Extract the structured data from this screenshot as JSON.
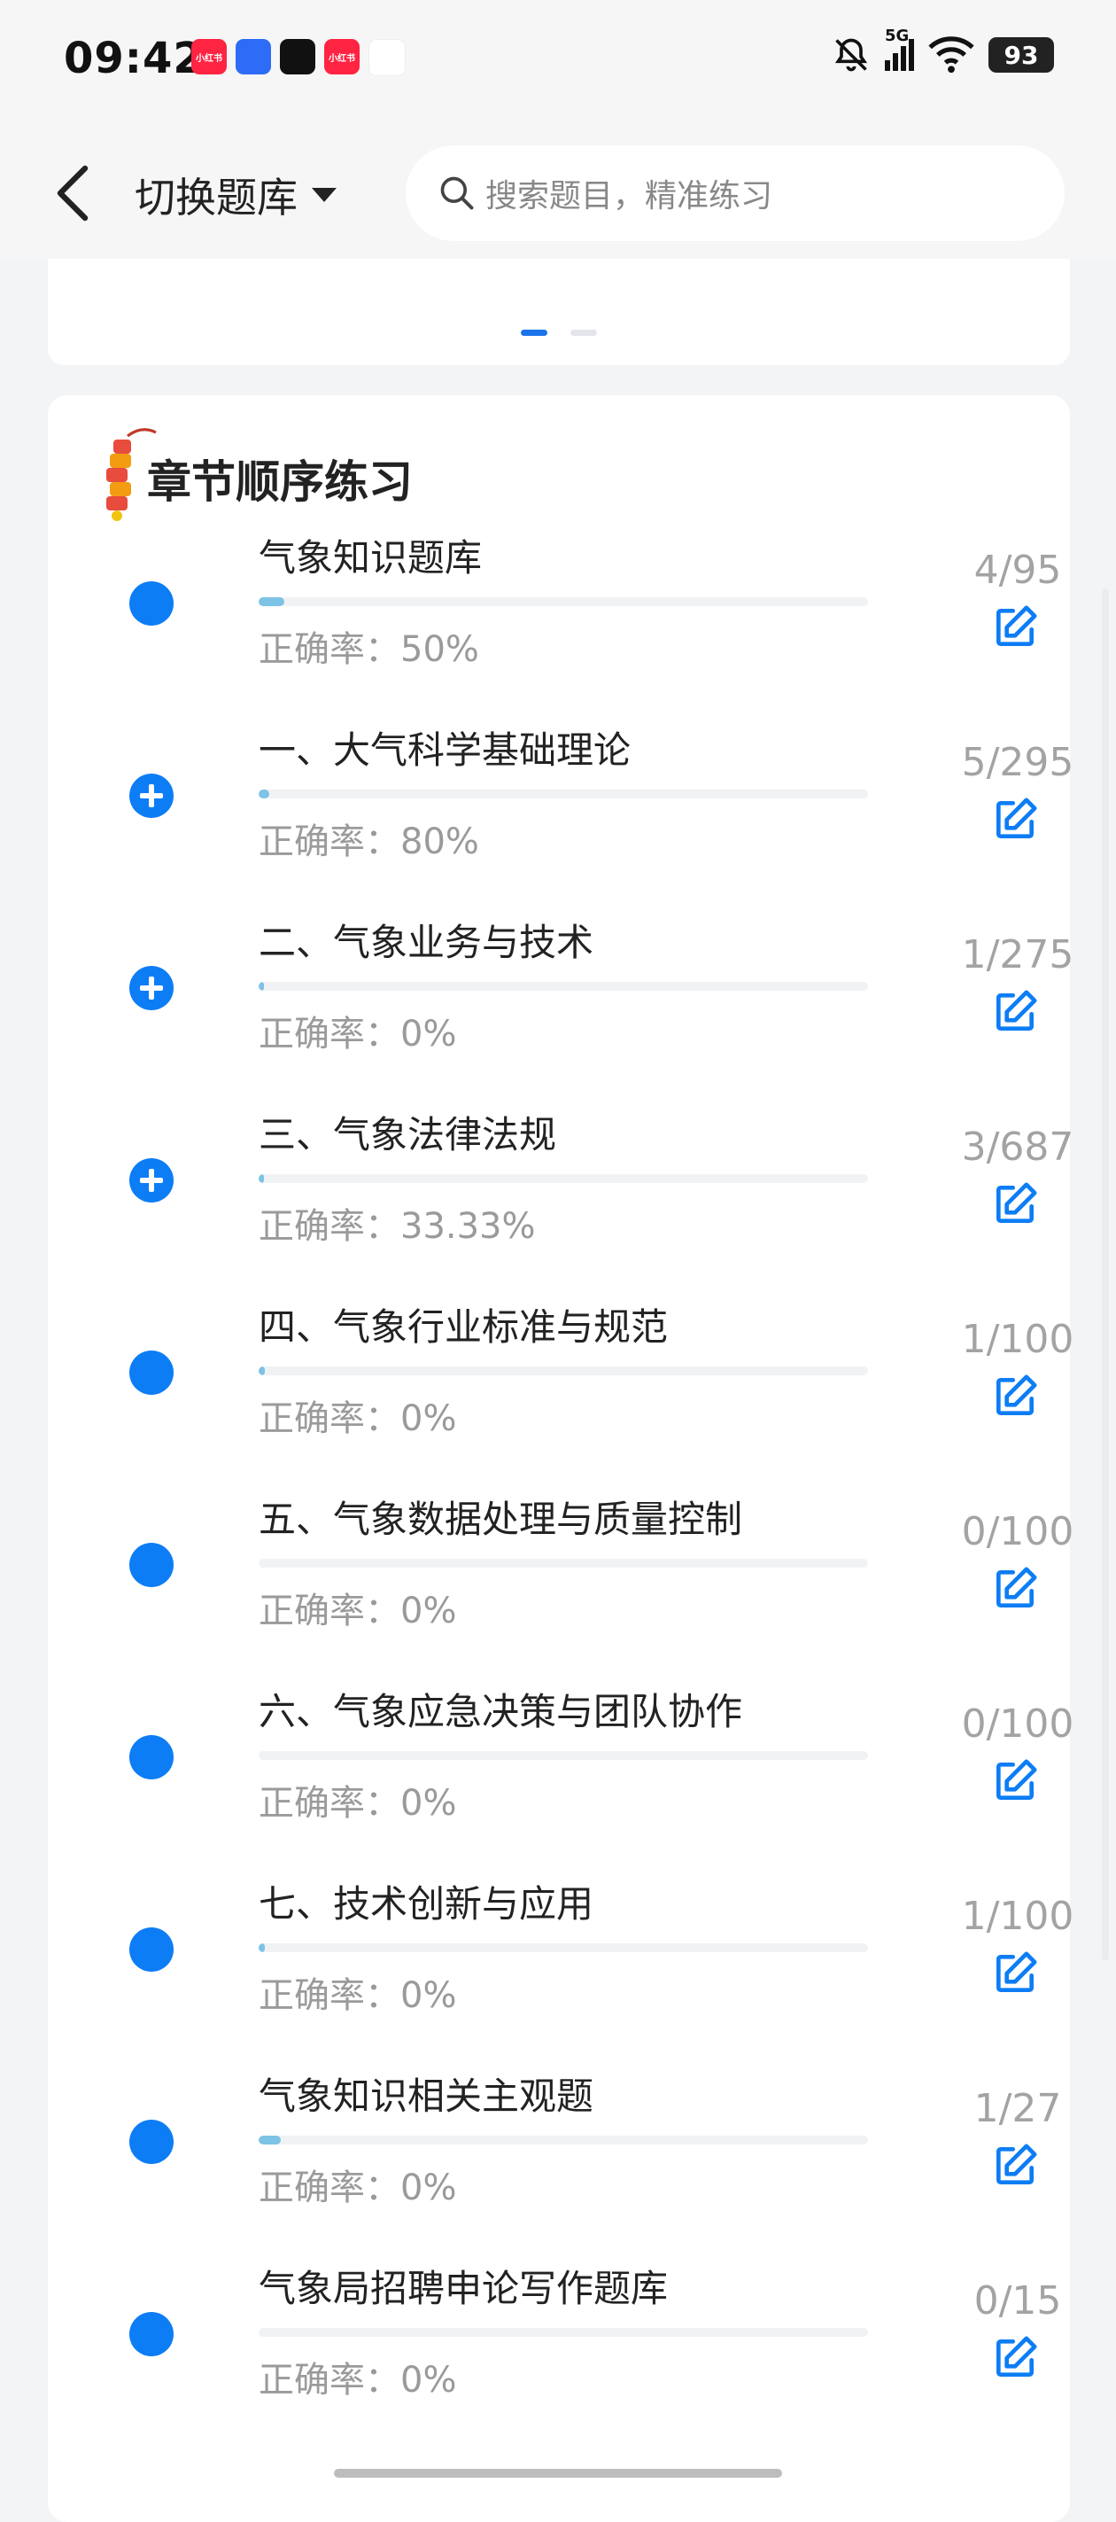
{
  "status_bar": {
    "time": "09:42",
    "network": "5G",
    "battery": "93",
    "app_icons": [
      {
        "name": "xiaohongshu-icon",
        "text": "小红书",
        "color": "#ff2442"
      },
      {
        "name": "tongyi-icon",
        "text": "",
        "color": "#2d6cf6"
      },
      {
        "name": "douyin-icon",
        "text": "",
        "color": "#111111"
      },
      {
        "name": "xiaohongshu-icon-2",
        "text": "小红书",
        "color": "#ff2442"
      },
      {
        "name": "mountain-app-icon",
        "text": "",
        "color": "#ffffff"
      }
    ]
  },
  "header": {
    "bank_switch_label": "切换题库",
    "search_placeholder": "搜索题目，精准练习"
  },
  "section": {
    "title": "章节顺序练习"
  },
  "accent_color": "#0d7df5",
  "chapters": [
    {
      "title": "气象知识题库",
      "accuracy": "正确率：50%",
      "count": "4/95",
      "progress": 0.042,
      "expandable": false
    },
    {
      "title": "一、大气科学基础理论",
      "accuracy": "正确率：80%",
      "count": "5/295",
      "progress": 0.017,
      "expandable": true
    },
    {
      "title": "二、气象业务与技术",
      "accuracy": "正确率：0%",
      "count": "1/275",
      "progress": 0.004,
      "expandable": true
    },
    {
      "title": "三、气象法律法规",
      "accuracy": "正确率：33.33%",
      "count": "3/687",
      "progress": 0.004,
      "expandable": true
    },
    {
      "title": "四、气象行业标准与规范",
      "accuracy": "正确率：0%",
      "count": "1/100",
      "progress": 0.01,
      "expandable": false
    },
    {
      "title": "五、气象数据处理与质量控制",
      "accuracy": "正确率：0%",
      "count": "0/100",
      "progress": 0.0,
      "expandable": false
    },
    {
      "title": "六、气象应急决策与团队协作",
      "accuracy": "正确率：0%",
      "count": "0/100",
      "progress": 0.0,
      "expandable": false
    },
    {
      "title": "七、技术创新与应用",
      "accuracy": "正确率：0%",
      "count": "1/100",
      "progress": 0.01,
      "expandable": false
    },
    {
      "title": "气象知识相关主观题",
      "accuracy": "正确率：0%",
      "count": "1/27",
      "progress": 0.037,
      "expandable": false
    },
    {
      "title": "气象局招聘申论写作题库",
      "accuracy": "正确率：0%",
      "count": "0/15",
      "progress": 0.0,
      "expandable": false
    }
  ]
}
